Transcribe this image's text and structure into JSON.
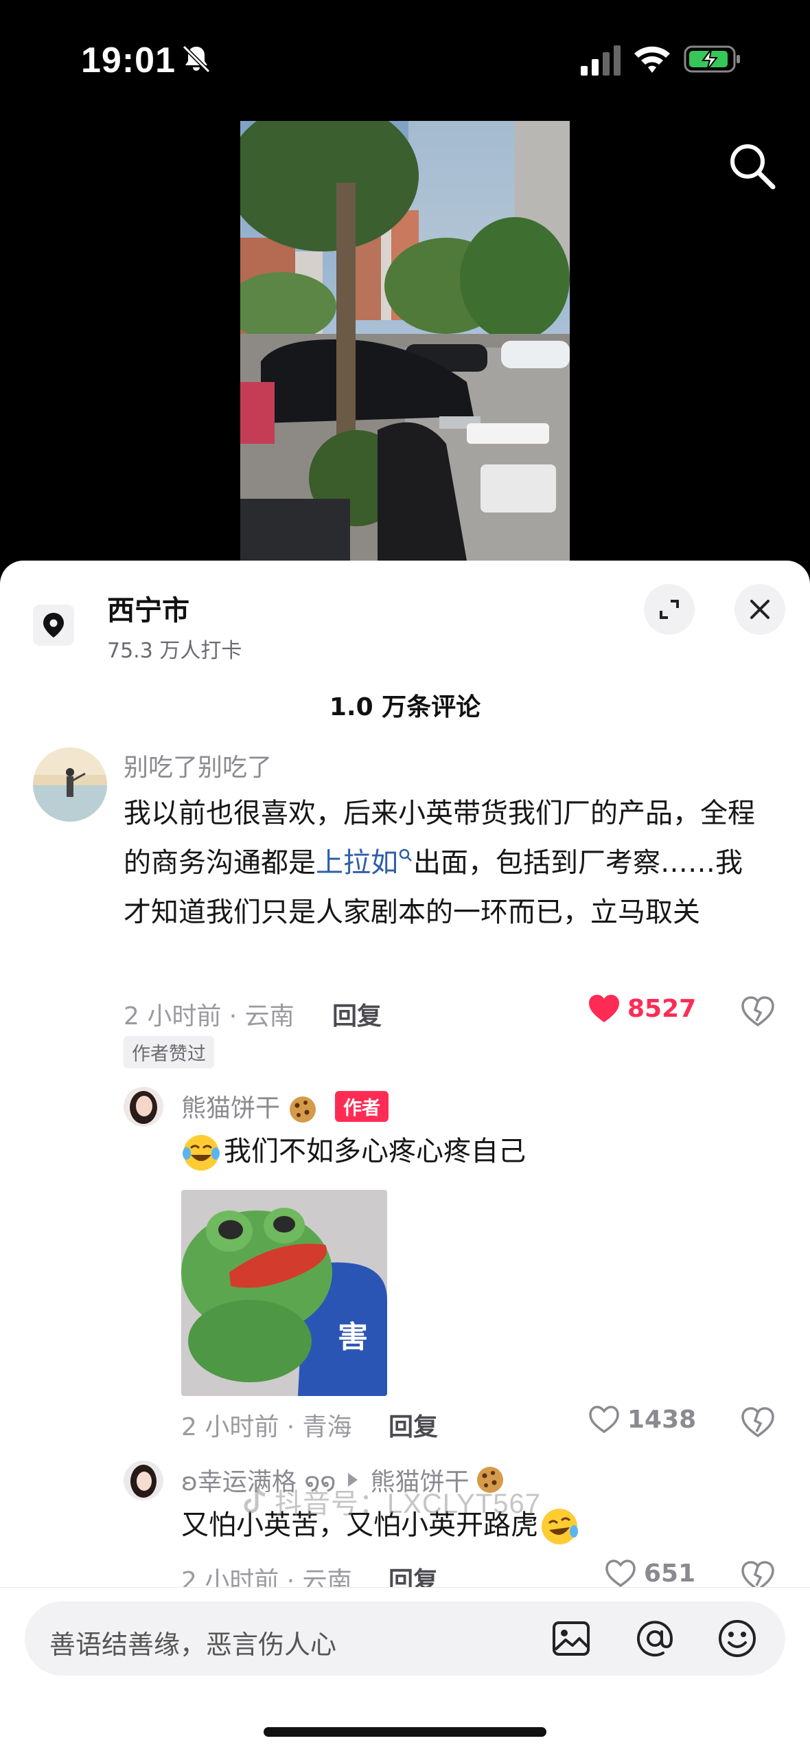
{
  "status_bar": {
    "time": "19:01"
  },
  "location": {
    "name": "西宁市",
    "checkins": "75.3 万人打卡"
  },
  "comments_header": "1.0 万条评论",
  "comments": [
    {
      "username": "别吃了别吃了",
      "text_before_link": "我以前也很喜欢，后来小英带货我们厂的产品，全程的商务沟通都是",
      "link": "上拉如",
      "text_after_link": "出面，包括到厂考察……我才知道我们只是人家剧本的一环而已，立马取关",
      "meta": "2 小时前 · 云南",
      "reply_label": "回复",
      "likes": "8527",
      "badge": "作者赞过"
    },
    {
      "username": "熊猫饼干",
      "author_tag": "作者",
      "text": "我们不如多心疼心疼自己",
      "sticker_text": "害",
      "meta": "2 小时前 · 青海",
      "reply_label": "回复",
      "likes": "1438"
    },
    {
      "username": "ʚ幸运满格 ໑໑",
      "reply_to": "熊猫饼干",
      "text": "又怕小英苦，又怕小英开路虎",
      "meta": "2 小时前 · 云南",
      "reply_label": "回复",
      "likes": "651"
    }
  ],
  "input": {
    "placeholder": "善语结善缘，恶言伤人心"
  },
  "watermark": "抖音号：LXCLYT567",
  "colors": {
    "like_red": "#fe2c55",
    "link_blue": "#2f5ea8",
    "author_tag": "#fe2c55"
  }
}
